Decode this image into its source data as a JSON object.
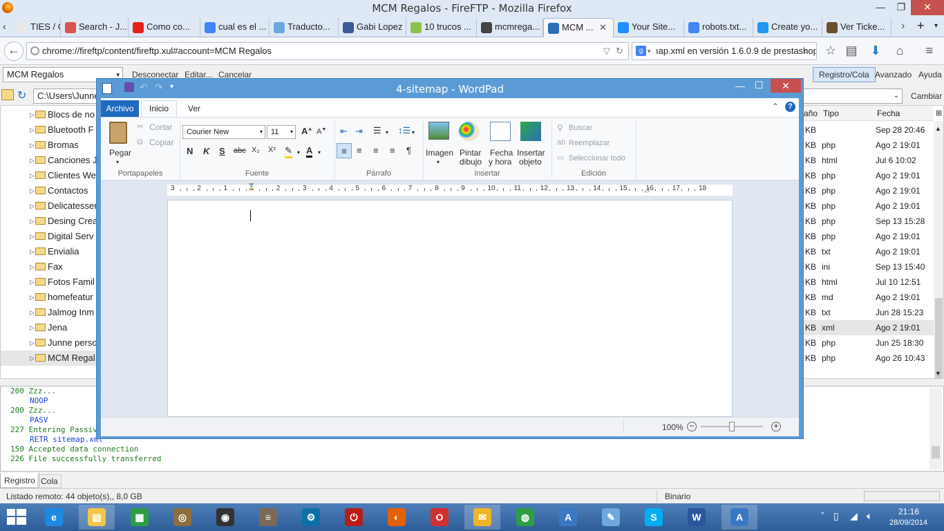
{
  "firefox": {
    "title": "MCM Regalos - FireFTP - Mozilla Firefox",
    "tabs": [
      {
        "label": "TIES / GA...",
        "color": "#e8e8e8"
      },
      {
        "label": "Search - J...",
        "color": "#d9534f"
      },
      {
        "label": "Como co...",
        "color": "#e62117"
      },
      {
        "label": "cual es el ...",
        "color": "#4285f4"
      },
      {
        "label": "Traducto...",
        "color": "#6aa8e0"
      },
      {
        "label": "Gabi Lopez",
        "color": "#3b5998"
      },
      {
        "label": "10 trucos ...",
        "color": "#8bc34a"
      },
      {
        "label": "mcmrega...",
        "color": "#444444"
      },
      {
        "label": "MCM ...",
        "color": "#2a6fb5"
      },
      {
        "label": "Your Site...",
        "color": "#1e90ff"
      },
      {
        "label": "robots.txt...",
        "color": "#4285f4"
      },
      {
        "label": "Create yo...",
        "color": "#2196f3"
      },
      {
        "label": "Ver Ticke...",
        "color": "#6b4e2e"
      }
    ],
    "url": "chrome://fireftp/content/fireftp.xul#account=MCM Regalos",
    "search_value": "ıap.xml en versión 1.6.0.9 de prestashop"
  },
  "ftp": {
    "account": "MCM Regalos",
    "menu": [
      "Desconectar",
      "Editar...",
      "Cancelar"
    ],
    "right_menu": [
      "Registro/Cola",
      "Avanzado",
      "Ayuda"
    ],
    "local_path": "C:\\Users\\Junne\\",
    "change_btn": "Cambiar",
    "tree": [
      "Blocs de no",
      "Bluetooth F",
      "Bromas",
      "Canciones J",
      "Clientes We",
      "Contactos",
      "Delicatesser",
      "Desing Crea",
      "Digital Serv",
      "Envialia",
      "Fax",
      "Fotos Famil",
      "homefeatur",
      "Jalmog Inm",
      "Jena",
      "Junne perso",
      "MCM Regal"
    ],
    "remote_headers": {
      "size": "año",
      "type": "Tipo",
      "date": "Fecha"
    },
    "remote_files": [
      {
        "size": "KB",
        "type": "",
        "date": "Sep 28 20:46"
      },
      {
        "size": "KB",
        "type": "php",
        "date": "Ago 2 19:01"
      },
      {
        "size": "KB",
        "type": "html",
        "date": "Jul 6 10:02"
      },
      {
        "size": "KB",
        "type": "php",
        "date": "Ago 2 19:01"
      },
      {
        "size": "KB",
        "type": "php",
        "date": "Ago 2 19:01"
      },
      {
        "size": "KB",
        "type": "php",
        "date": "Ago 2 19:01"
      },
      {
        "size": "KB",
        "type": "php",
        "date": "Sep 13 15:28"
      },
      {
        "size": "KB",
        "type": "php",
        "date": "Ago 2 19:01"
      },
      {
        "size": "KB",
        "type": "txt",
        "date": "Ago 2 19:01"
      },
      {
        "size": "KB",
        "type": "ini",
        "date": "Sep 13 15:40"
      },
      {
        "size": "KB",
        "type": "html",
        "date": "Jul 10 12:51"
      },
      {
        "size": "KB",
        "type": "md",
        "date": "Ago 2 19:01"
      },
      {
        "size": "KB",
        "type": "txt",
        "date": "Jun 28 15:23"
      },
      {
        "size": "KB",
        "type": "xml",
        "date": "Ago 2 19:01"
      },
      {
        "size": "KB",
        "type": "php",
        "date": "Jun 25 18:30"
      },
      {
        "size": "KB",
        "type": "php",
        "date": "Ago 26 10:43"
      }
    ],
    "log": [
      {
        "text": "200 Zzz...",
        "color": "#1f7a1f",
        "indent": false
      },
      {
        "text": "NOOP",
        "color": "#1a3fcf",
        "indent": true
      },
      {
        "text": "200 Zzz...",
        "color": "#1f7a1f",
        "indent": false
      },
      {
        "text": "PASV",
        "color": "#1a3fcf",
        "indent": true
      },
      {
        "text": "227 Entering Passive",
        "color": "#1f7a1f",
        "indent": false
      },
      {
        "text": "RETR sitemap.xml",
        "color": "#1a3fcf",
        "indent": true
      },
      {
        "text": "150 Accepted data connection",
        "color": "#1f7a1f",
        "indent": false
      },
      {
        "text": "226 File successfully transferred",
        "color": "#1f7a1f",
        "indent": false
      }
    ],
    "bottom_tabs": [
      "Registro",
      "Cola"
    ],
    "status_left": "Listado remoto: 44 objeto(s),, 8,0 GB",
    "status_mode": "Binario"
  },
  "wordpad": {
    "title": "4-sitemap - WordPad",
    "tabs": [
      "Archivo",
      "Inicio",
      "Ver"
    ],
    "clipboard": {
      "paste": "Pegar",
      "cut": "Cortar",
      "copy": "Copiar",
      "group": "Portapapeles"
    },
    "font": {
      "family": "Courier New",
      "size": "11",
      "group": "Fuente",
      "bold": "N",
      "italic": "K",
      "underline": "S",
      "strike": "abc",
      "sub": "X₂",
      "sup": "X²"
    },
    "paragraph": {
      "group": "Párrafo"
    },
    "insert": {
      "image": "Imagen",
      "paint1": "Pintar",
      "paint2": "dibujo",
      "date1": "Fecha",
      "date2": "y hora",
      "obj1": "Insertar",
      "obj2": "objeto",
      "group": "Insertar"
    },
    "editing": {
      "find": "Buscar",
      "replace": "Reemplazar",
      "select_all": "Seleccionar todo",
      "group": "Edición"
    },
    "ruler": [
      "3",
      "2",
      "1",
      "1",
      "2",
      "3",
      "4",
      "5",
      "6",
      "7",
      "8",
      "9",
      "10",
      "11",
      "12",
      "13",
      "14",
      "15",
      "16",
      "17",
      "18"
    ],
    "zoom": "100%",
    "zoom_level": 0.5
  },
  "clock": {
    "time": "21:16",
    "date": "28/09/2014"
  },
  "taskbar": [
    {
      "name": "ie",
      "color": "#1e88e5",
      "glyph": "e"
    },
    {
      "name": "explorer",
      "color": "#f3c54b",
      "glyph": "▤"
    },
    {
      "name": "store",
      "color": "#2e9e44",
      "glyph": "▦"
    },
    {
      "name": "webcam",
      "color": "#8d6e3f",
      "glyph": "◎"
    },
    {
      "name": "speaker",
      "color": "#333333",
      "glyph": "◉"
    },
    {
      "name": "doc",
      "color": "#7a6a55",
      "glyph": "≡"
    },
    {
      "name": "task",
      "color": "#0e6fa8",
      "glyph": "⚙"
    },
    {
      "name": "power",
      "color": "#b71c1c",
      "glyph": "⏻"
    },
    {
      "name": "firefox",
      "color": "#e66000",
      "glyph": "◐"
    },
    {
      "name": "opera",
      "color": "#d32f2f",
      "glyph": "O"
    },
    {
      "name": "outlook",
      "color": "#f0b429",
      "glyph": "✉"
    },
    {
      "name": "chrome",
      "color": "#2e9e44",
      "glyph": "◍"
    },
    {
      "name": "wordpad",
      "color": "#3b78c4",
      "glyph": "A"
    },
    {
      "name": "paint",
      "color": "#6fa8dc",
      "glyph": "✎"
    },
    {
      "name": "skype",
      "color": "#00aff0",
      "glyph": "S"
    },
    {
      "name": "word",
      "color": "#2b579a",
      "glyph": "W"
    },
    {
      "name": "wordpad2",
      "color": "#3b78c4",
      "glyph": "A"
    }
  ]
}
